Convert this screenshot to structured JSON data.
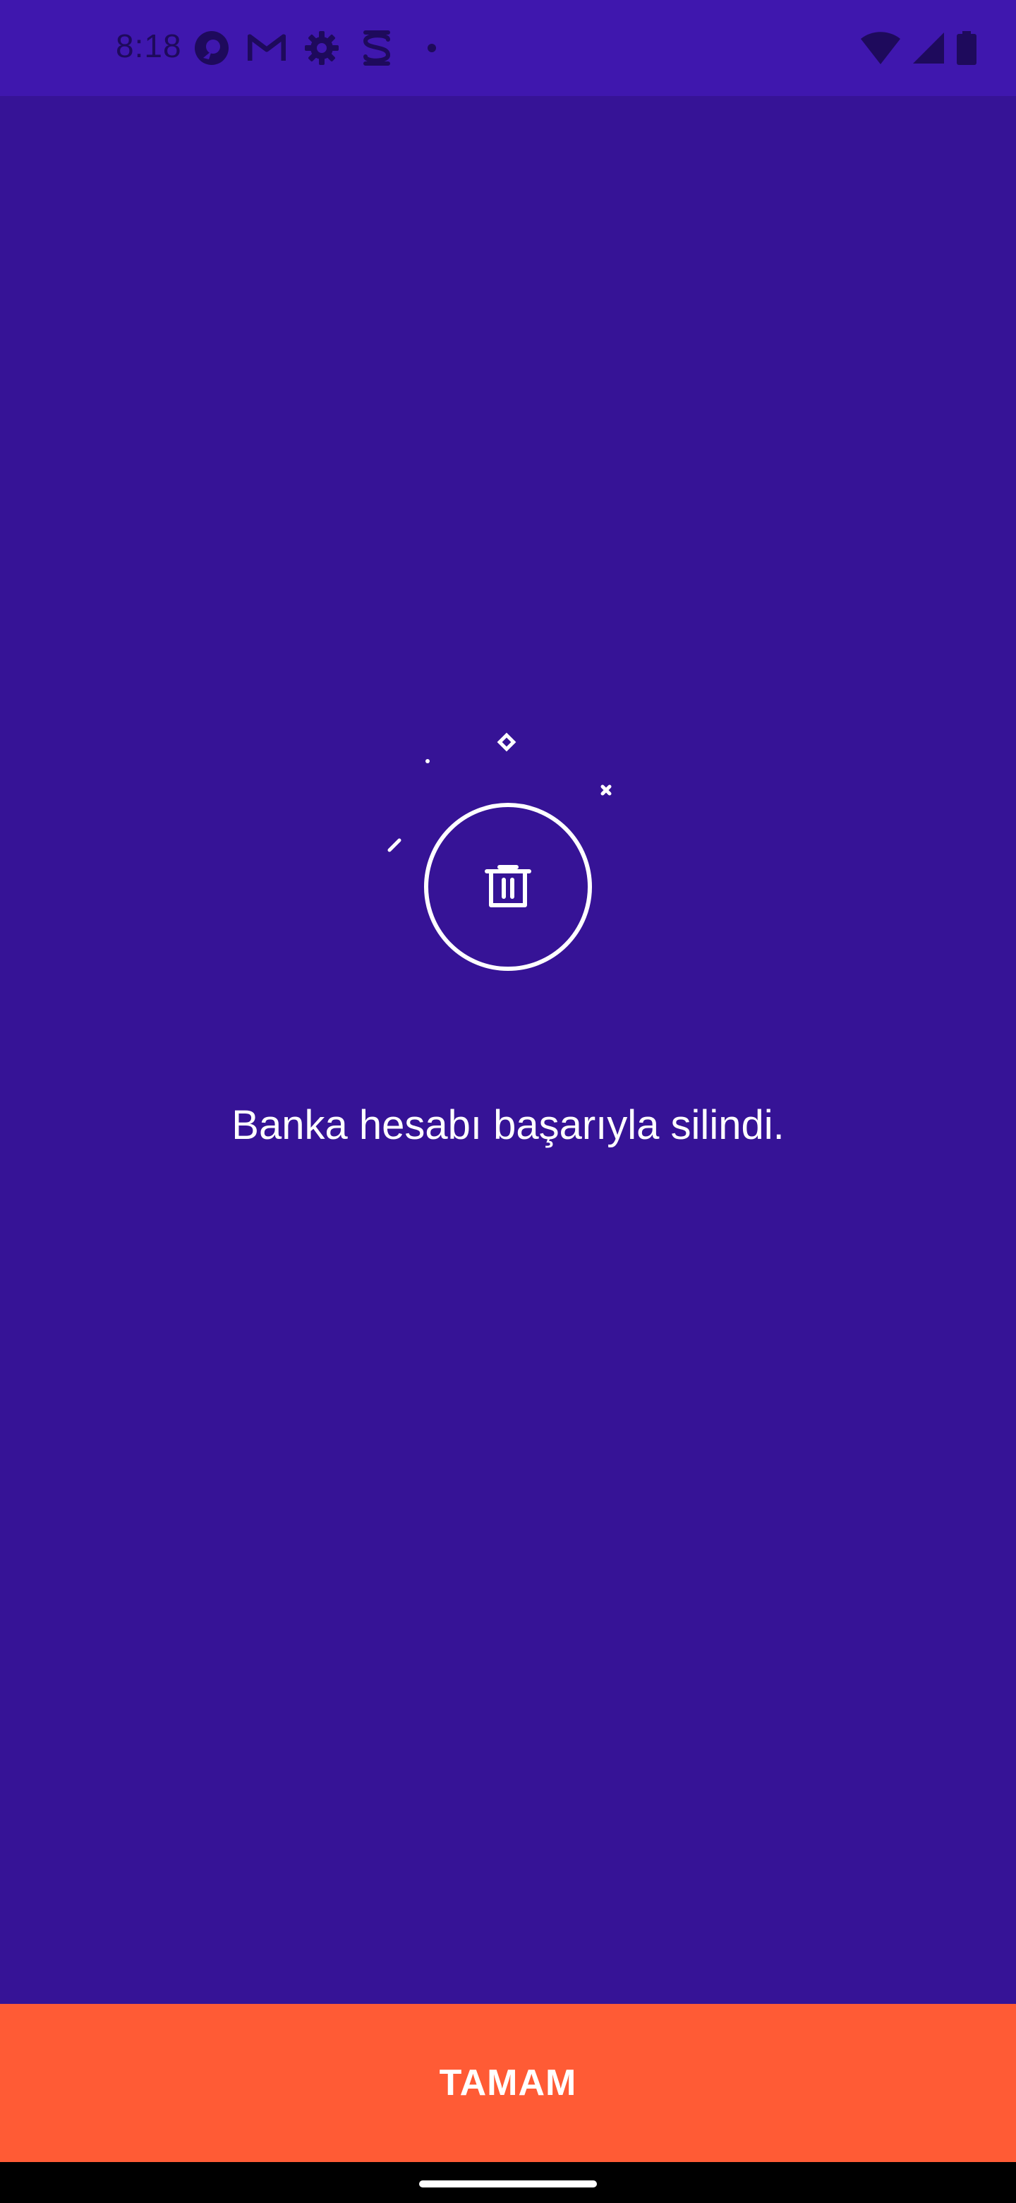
{
  "status_bar": {
    "time": "8:18",
    "left_icons": [
      "record-icon",
      "gmail-icon",
      "settings-icon",
      "s-app-icon",
      "dot-icon"
    ],
    "right_icons": [
      "wifi-icon",
      "signal-icon",
      "battery-icon"
    ]
  },
  "main": {
    "icon": "trash-icon",
    "message": "Banka hesabı başarıyla silindi."
  },
  "footer": {
    "button_label": "TAMAM"
  },
  "colors": {
    "background": "#361396",
    "status_bar": "#3f17ae",
    "button": "#ff5b35",
    "text": "#ffffff"
  }
}
